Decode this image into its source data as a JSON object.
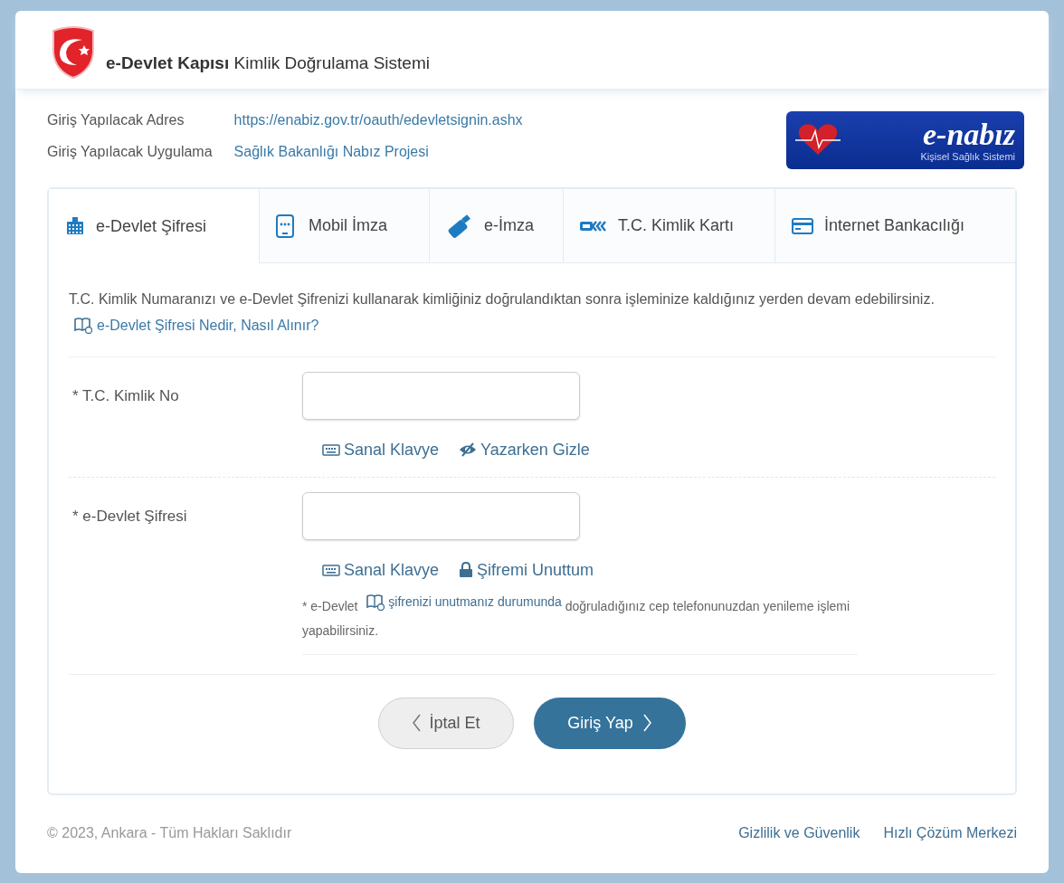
{
  "header": {
    "title": "**e-Devlet Kapısı** Kimlik Doğrulama Sistemi"
  },
  "info": [
    {
      "label": "Giriş Yapılacak Adres",
      "value": "https://enabiz.gov.tr/oauth/edevletsignin.ashx"
    },
    {
      "label": "Giriş Yapılacak Uygulama",
      "value": "Sağlık Bakanlığı Nabız Projesi"
    }
  ],
  "app_logo": {
    "name": "e-nabız",
    "subtitle": "Kişisel Sağlık Sistemi"
  },
  "tabs": [
    {
      "label": "e-Devlet Şifresi",
      "kind": "keypad",
      "selected": true
    },
    {
      "label": "Mobil İmza",
      "kind": "phone",
      "selected": false
    },
    {
      "label": "e-İmza",
      "kind": "usb",
      "selected": false
    },
    {
      "label": "T.C. Kimlik Kartı",
      "kind": "idcard",
      "selected": false
    },
    {
      "label": "İnternet Bankacılığı",
      "kind": "card",
      "selected": false
    }
  ],
  "description": {
    "text": "T.C. Kimlik Numaranızı ve e-Devlet Şifrenizi kullanarak kimliğiniz doğrulandıktan sonra işleminize kaldığınız yerden devam edebilirsiniz.",
    "link": "e-Devlet Şifresi Nedir, Nasıl Alınır?"
  },
  "fields": [
    {
      "label": "* T.C. Kimlik No",
      "links": [
        {
          "kind": "keyboard",
          "label": "Sanal Klavye"
        },
        {
          "kind": "eye",
          "label": "Yazarken Gizle"
        }
      ]
    },
    {
      "label": "* e-Devlet Şifresi",
      "links": [
        {
          "kind": "keyboard",
          "label": "Sanal Klavye"
        },
        {
          "kind": "lock",
          "label": "Şifremi Unuttum"
        }
      ]
    }
  ],
  "note": {
    "prefix": "* e-Devlet",
    "link": "şifrenizi unutmanız durumunda",
    "suffix": "doğruladığınız cep telefonunuzdan yenileme işlemi yapabilirsiniz."
  },
  "buttons": [
    {
      "kind": "cancel",
      "label": "İptal Et"
    },
    {
      "kind": "submit",
      "label": "Giriş Yap"
    }
  ],
  "footer": {
    "copyright": "© 2023, Ankara - Tüm Hakları Saklıdır",
    "links": [
      "Gizlilik ve Güvenlik",
      "Hızlı Çözüm Merkezi"
    ]
  }
}
